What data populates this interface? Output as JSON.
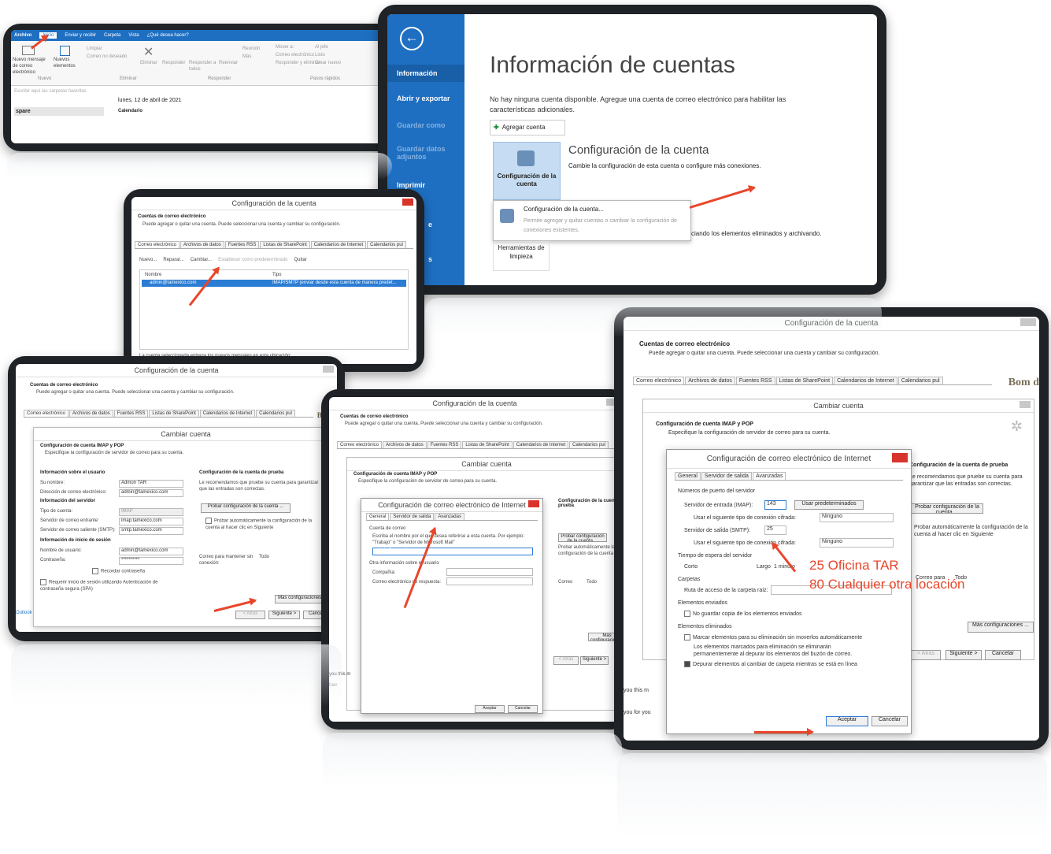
{
  "outlook_ribbon": {
    "tabs": [
      "Archivo",
      "Inicio",
      "Enviar y recibir",
      "Carpeta",
      "Vista",
      "¿Qué desea hacer?"
    ],
    "groups": [
      "Nuevo",
      "Eliminar",
      "Responder",
      "Pasos rápidos"
    ],
    "buttons": [
      "Nuevo mensaje de correo electrónico",
      "Nuevos elementos",
      "Limpiar",
      "Correo no deseado",
      "Eliminar",
      "Responder",
      "Responder a todos",
      "Reenviar",
      "Reunión",
      "Más",
      "Mover a:",
      "Al jefe",
      "Correo electrónico",
      "Listo",
      "Responder y eliminar",
      "Crear nuevo"
    ],
    "search_placeholder": "Escribir aquí las carpetas favoritas",
    "date": "lunes, 12 de abril de 2021",
    "folder": "spare",
    "calendar_label": "Calendario"
  },
  "backstage": {
    "nav": [
      "Información",
      "Abrir y exportar",
      "Guardar como",
      "Guardar datos adjuntos",
      "Imprimir",
      "e",
      "s"
    ],
    "title": "Información de cuentas",
    "no_account_text": "No hay ninguna cuenta disponible. Agregue una cuenta de correo electrónico para habilitar las características adicionales.",
    "add_account": "Agregar cuenta",
    "config_button": "Configuración de la cuenta",
    "config_title": "Configuración de la cuenta",
    "config_desc": "Cambie la configuración de esta cuenta o configure más conexiones.",
    "menu_item_title": "Configuración de la cuenta...",
    "menu_item_desc": "Permite agregar y quitar cuentas o cambiar la configuración de conexiones existentes.",
    "cleanup_button": "Herramientas de limpieza",
    "cleanup_desc": "ciando los elementos eliminados y archivando."
  },
  "acct_settings": {
    "title": "Configuración de la cuenta",
    "heading": "Cuentas de correo electrónico",
    "subheading": "Puede agregar o quitar una cuenta. Puede seleccionar una cuenta y cambiar su configuración.",
    "tabs": [
      "Correo electrónico",
      "Archivos de datos",
      "Fuentes RSS",
      "Listas de SharePoint",
      "Calendarios de Internet",
      "Calendarios pul"
    ],
    "toolbar": [
      "Nuevo...",
      "Reparar...",
      "Cambiar...",
      "Establecer como predeterminado",
      "Quitar"
    ],
    "col_name": "Nombre",
    "col_type": "Tipo",
    "row_name": "admin@tamexico.com",
    "row_type": "IMAP/SMTP (enviar desde esta cuenta de manera predet...",
    "footer": "La cuenta seleccionada entrega los nuevos mensajes en esta ubicación:"
  },
  "change_acct": {
    "title": "Cambiar cuenta",
    "heading": "Configuración de cuenta IMAP y POP",
    "subheading": "Especifique la configuración de servidor de correo para su cuenta.",
    "user_info": "Información sobre el usuario",
    "your_name_label": "Su nombre:",
    "your_name": "Admon TAR",
    "email_label": "Dirección de correo electrónico:",
    "email": "admin@tamexico.com",
    "server_info": "Información del servidor",
    "account_type_label": "Tipo de cuenta:",
    "account_type": "IMAP",
    "incoming_label": "Servidor de correo entrante:",
    "incoming": "imap.tamexico.com",
    "outgoing_label": "Servidor de correo saliente (SMTP):",
    "outgoing": "smtp.tamexico.com",
    "logon_info": "Información de inicio de sesión",
    "username_label": "Nombre de usuario:",
    "username": "admin@tamexico.com",
    "password_label": "Contraseña:",
    "password": "**********",
    "remember_pwd": "Recordar contraseña",
    "spa": "Requerir inicio de sesión utilizando Autenticación de contraseña segura (SPA)",
    "test_heading": "Configuración de la cuenta de prueba",
    "test_desc": "Le recomendamos que pruebe su cuenta para garantizar que las entradas son correctas.",
    "test_button": "Probar configuración de la cuenta ...",
    "auto_test": "Probar automáticamente la configuración de la cuenta al hacer clic en Siguiente",
    "keep_offline": "Correo para mantener sin conexión:",
    "keep_value": "Todo",
    "more_settings": "Más configuraciones ...",
    "back": "< Atrás",
    "next": "Siguiente >",
    "cancel": "Cancelar",
    "bom": "Bom d"
  },
  "inet_email": {
    "title": "Configuración de correo electrónico de Internet",
    "tabs": [
      "General",
      "Servidor de salida",
      "Avanzadas"
    ],
    "general_section": "Cuenta de correo",
    "general_desc": "Escriba el nombre por el que desea referirse a esta cuenta. Por ejemplo: \"Trabajo\" o \"Servidor de Microsoft Mail\"",
    "account_name": "admin@tamexico.com",
    "other_info": "Otra información sobre el usuario",
    "company_label": "Compañía:",
    "reply_label": "Correo electrónico de respuesta:",
    "ports_section": "Números de puerto del servidor",
    "incoming_port_label": "Servidor de entrada (IMAP):",
    "incoming_port": "143",
    "use_defaults": "Usar predeterminados",
    "enc_in_label": "Usar el siguiente tipo de conexión cifrada:",
    "enc_none": "Ninguno",
    "outgoing_port_label": "Servidor de salida (SMTP):",
    "outgoing_port": "25",
    "timeouts": "Tiempo de espera del servidor",
    "short": "Corto",
    "long": "Largo",
    "minute": "1 minuto",
    "folders": "Carpetas",
    "root_path": "Ruta de acceso de la carpeta raíz:",
    "sent_items": "Elementos enviados",
    "no_save_copy": "No guardar copia de los elementos enviados",
    "deleted_items": "Elementos eliminados",
    "mark_delete": "Marcar elementos para su eliminación sin moverlos automáticamente",
    "mark_desc": "Los elementos marcados para eliminación se eliminarán permanentemente al depurar los elementos del buzón de correo.",
    "purge": "Depurar elementos al cambiar de carpeta mientras se está en línea",
    "ok": "Aceptar",
    "cancel": "Cancelar"
  },
  "annotation": {
    "line1": "25 Oficina TAR",
    "line2": "80 Cualquier otra locación",
    "color": "#e8462b"
  },
  "fragments": {
    "you_this": "you this m",
    "you_for": "you for you",
    "bom": "Bom d",
    "outlook": "Outlook",
    "fuer": "fuer"
  }
}
